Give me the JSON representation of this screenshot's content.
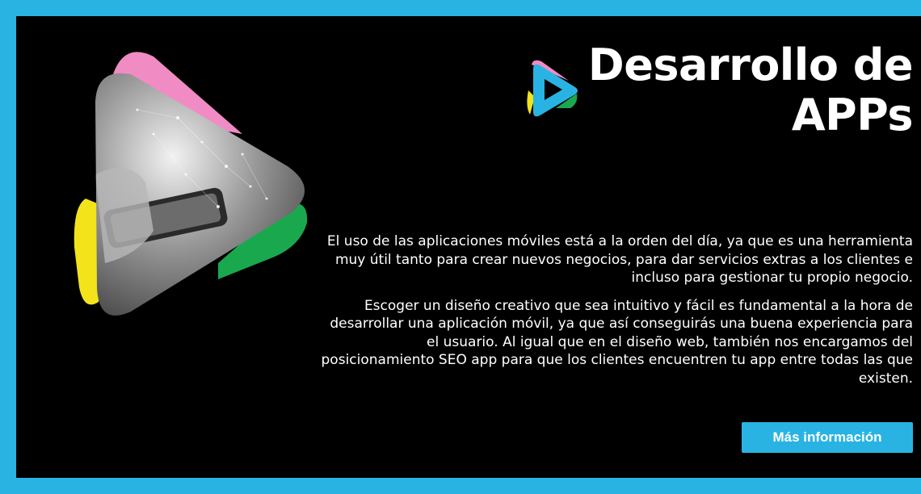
{
  "colors": {
    "accent": "#29b3e3",
    "background": "#000000",
    "text": "#ffffff",
    "pink": "#f08cc3",
    "yellow": "#f2e31b",
    "green": "#1aa84f"
  },
  "hero": {
    "image_icon": "play-triangle-phone-image",
    "logo_icon": "play-logo-icon"
  },
  "title": {
    "line1": "Desarrollo de",
    "line2": "APPs"
  },
  "body": {
    "paragraph1": "El uso de las aplicaciones móviles está a la orden del día, ya que es una herramienta muy útil tanto para crear nuevos negocios, para dar servicios extras a los clientes e incluso para gestionar tu propio negocio.",
    "paragraph2": "Escoger un diseño creativo que sea intuitivo y fácil es fundamental a la hora de desarrollar una aplicación móvil, ya que así conseguirás una buena experiencia para el usuario. Al igual que en el diseño web, también nos encargamos del posicionamiento SEO app para que los clientes encuentren tu app entre todas las que existen."
  },
  "cta": {
    "label": "Más información"
  }
}
